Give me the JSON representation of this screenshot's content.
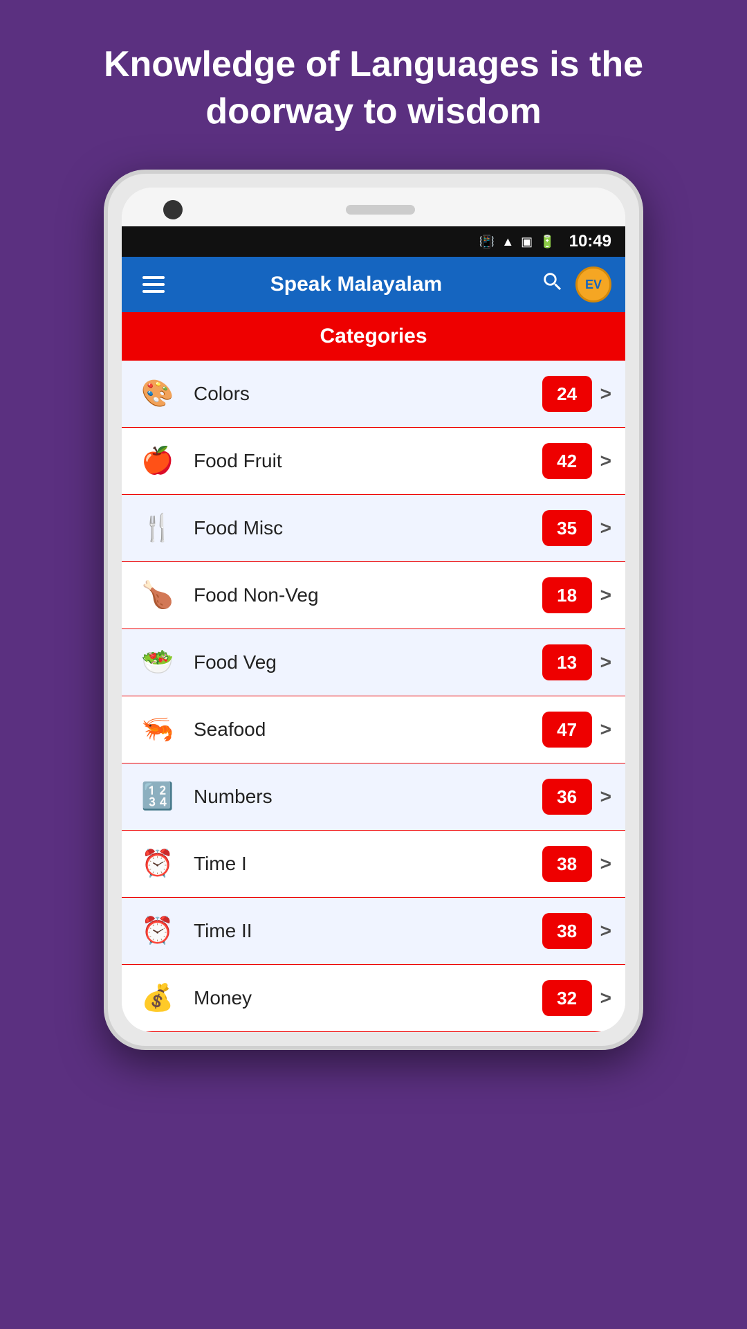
{
  "quote": {
    "line1": "Knowledge of Languages is",
    "line2": "the doorway to wisdom",
    "full": "Knowledge of Languages is the doorway to wisdom"
  },
  "statusBar": {
    "time": "10:49",
    "icons": [
      "vibrate",
      "wifi",
      "signal",
      "battery"
    ]
  },
  "appBar": {
    "title": "Speak Malayalam",
    "searchLabel": "search",
    "menuLabel": "menu",
    "badgeText": "EV"
  },
  "categoriesHeader": "Categories",
  "categories": [
    {
      "id": "colors",
      "name": "Colors",
      "count": 24,
      "icon": "🎨"
    },
    {
      "id": "food-fruit",
      "name": "Food Fruit",
      "count": 42,
      "icon": "🍎"
    },
    {
      "id": "food-misc",
      "name": "Food Misc",
      "count": 35,
      "icon": "🍴"
    },
    {
      "id": "food-non-veg",
      "name": "Food Non-Veg",
      "count": 18,
      "icon": "🍗"
    },
    {
      "id": "food-veg",
      "name": "Food Veg",
      "count": 13,
      "icon": "🥗"
    },
    {
      "id": "seafood",
      "name": "Seafood",
      "count": 47,
      "icon": "🦐"
    },
    {
      "id": "numbers",
      "name": "Numbers",
      "count": 36,
      "icon": "🔢"
    },
    {
      "id": "time-i",
      "name": "Time I",
      "count": 38,
      "icon": "⏰"
    },
    {
      "id": "time-ii",
      "name": "Time II",
      "count": 38,
      "icon": "⏰"
    },
    {
      "id": "money",
      "name": "Money",
      "count": 32,
      "icon": "💰"
    }
  ]
}
